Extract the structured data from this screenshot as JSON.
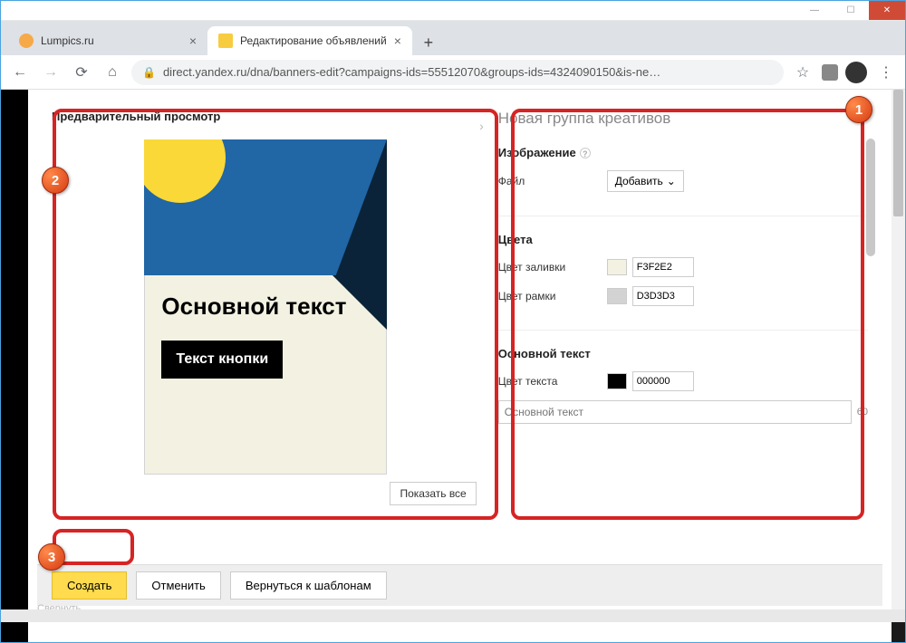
{
  "window": {
    "min": "—",
    "max": "☐",
    "close": "✕"
  },
  "tabs": {
    "items": [
      {
        "title": "Lumpics.ru",
        "favicon": "#f7a948"
      },
      {
        "title": "Редактирование объявлений",
        "favicon": "#f7cc3f"
      }
    ],
    "new_tab": "+"
  },
  "address": {
    "url": "direct.yandex.ru/dna/banners-edit?campaigns-ids=55512070&groups-ids=4324090150&is-ne…",
    "star": "☆",
    "menu": "⋮"
  },
  "modal": {
    "close": "×",
    "preview_title": "Предварительный просмотр",
    "side_arrow": "›",
    "banner_main_text": "Основной текст",
    "banner_button_text": "Текст кнопки",
    "show_all": "Показать все"
  },
  "settings": {
    "title": "Новая группа креативов",
    "image_section": "Изображение",
    "file_label": "Файл",
    "add_btn": "Добавить",
    "colors_section": "Цвета",
    "fill_label": "Цвет заливки",
    "fill_value": "F3F2E2",
    "fill_swatch": "#F3F2E2",
    "border_label": "Цвет рамки",
    "border_value": "D3D3D3",
    "border_swatch": "#D3D3D3",
    "maintext_section": "Основной текст",
    "textcolor_label": "Цвет текста",
    "textcolor_value": "000000",
    "textcolor_swatch": "#000000",
    "main_placeholder": "Основной текст",
    "char_limit": "60"
  },
  "footer": {
    "create": "Создать",
    "cancel": "Отменить",
    "back": "Вернуться к шаблонам"
  },
  "bottom_text": "Свернуть",
  "markers": {
    "m1": "1",
    "m2": "2",
    "m3": "3"
  }
}
